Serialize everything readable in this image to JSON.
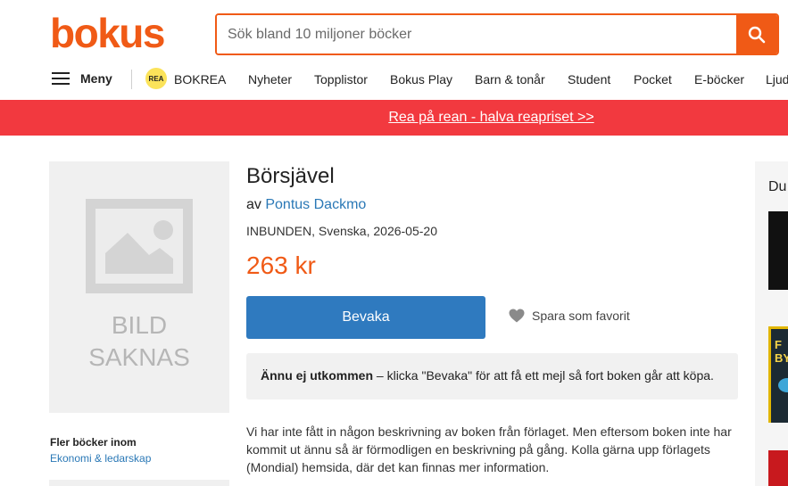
{
  "header": {
    "logo": "bokus",
    "search_placeholder": "Sök bland 10 miljoner böcker"
  },
  "nav": {
    "menu_label": "Meny",
    "rea_badge": "REA",
    "items": [
      "BOKREA",
      "Nyheter",
      "Topplistor",
      "Bokus Play",
      "Barn & tonår",
      "Student",
      "Pocket",
      "E-böcker",
      "Ljud"
    ]
  },
  "banner": {
    "link_text": "Rea på rean - halva reapriset >>",
    "color": "#f2393f"
  },
  "image": {
    "caption_line1": "BILD",
    "caption_line2": "SAKNAS"
  },
  "sidebar": {
    "more_label": "Fler böcker inom",
    "category_link": "Ekonomi & ledarskap"
  },
  "product": {
    "title": "Börsjävel",
    "author_prefix": "av",
    "author": "Pontus Dackmo",
    "format_info": "INBUNDEN, Svenska, 2026-05-20",
    "price": "263 kr",
    "watch_button": "Bevaka",
    "favorite_label": "Spara som favorit",
    "notice_strong": "Ännu ej utkommen",
    "notice_text": " – klicka \"Bevaka\" för att få ett mejl så fort boken går att köpa.",
    "description": "Vi har inte fått in någon beskrivning av boken från förlaget. Men eftersom boken inte har kommit ut ännu så är förmodligen en beskrivning på gång. Kolla gärna upp förlagets (Mondial) hemsida, där det kan finnas mer information."
  },
  "right_panel": {
    "heading": "Du",
    "thumb2_text": "F BY"
  },
  "colors": {
    "brand": "#f05a16",
    "link": "#2a78b6",
    "button": "#2f7abf"
  }
}
